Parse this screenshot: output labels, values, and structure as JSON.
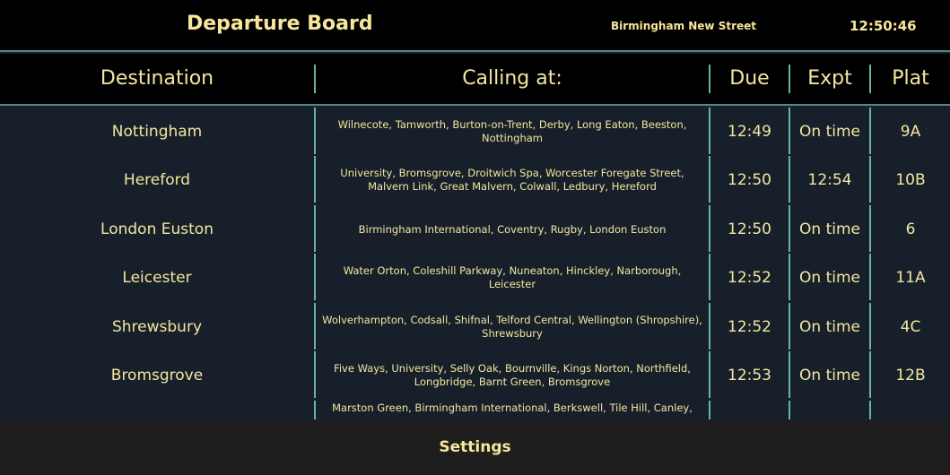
{
  "header": {
    "title": "Departure Board",
    "station": "Birmingham New Street",
    "clock": "12:50:46"
  },
  "columns": {
    "destination": "Destination",
    "calling_at": "Calling at:",
    "due": "Due",
    "expected": "Expt",
    "platform": "Plat"
  },
  "departures": [
    {
      "destination": "Nottingham",
      "calling_at": "Wilnecote, Tamworth, Burton-on-Trent, Derby, Long Eaton, Beeston, Nottingham",
      "due": "12:49",
      "expected": "On time",
      "platform": "9A"
    },
    {
      "destination": "Hereford",
      "calling_at": "University, Bromsgrove, Droitwich Spa, Worcester Foregate Street, Malvern Link, Great Malvern, Colwall, Ledbury, Hereford",
      "due": "12:50",
      "expected": "12:54",
      "platform": "10B"
    },
    {
      "destination": "London Euston",
      "calling_at": "Birmingham International, Coventry, Rugby, London Euston",
      "due": "12:50",
      "expected": "On time",
      "platform": "6"
    },
    {
      "destination": "Leicester",
      "calling_at": "Water Orton, Coleshill Parkway, Nuneaton, Hinckley, Narborough, Leicester",
      "due": "12:52",
      "expected": "On time",
      "platform": "11A"
    },
    {
      "destination": "Shrewsbury",
      "calling_at": "Wolverhampton, Codsall, Shifnal, Telford Central, Wellington (Shropshire), Shrewsbury",
      "due": "12:52",
      "expected": "On time",
      "platform": "4C"
    },
    {
      "destination": "Bromsgrove",
      "calling_at": "Five Ways, University, Selly Oak, Bournville, Kings Norton, Northfield, Longbridge, Barnt Green, Bromsgrove",
      "due": "12:53",
      "expected": "On time",
      "platform": "12B"
    },
    {
      "destination": "",
      "calling_at": "Marston Green, Birmingham International, Berkswell, Tile Hill, Canley,",
      "due": "",
      "expected": "",
      "platform": ""
    }
  ],
  "footer": {
    "settings_label": "Settings"
  },
  "colors": {
    "text": "#f2e6a0",
    "background": "#17202a",
    "header_background": "#000000",
    "divider": "#6fb0a6",
    "footer_background": "#1e1e1e"
  }
}
